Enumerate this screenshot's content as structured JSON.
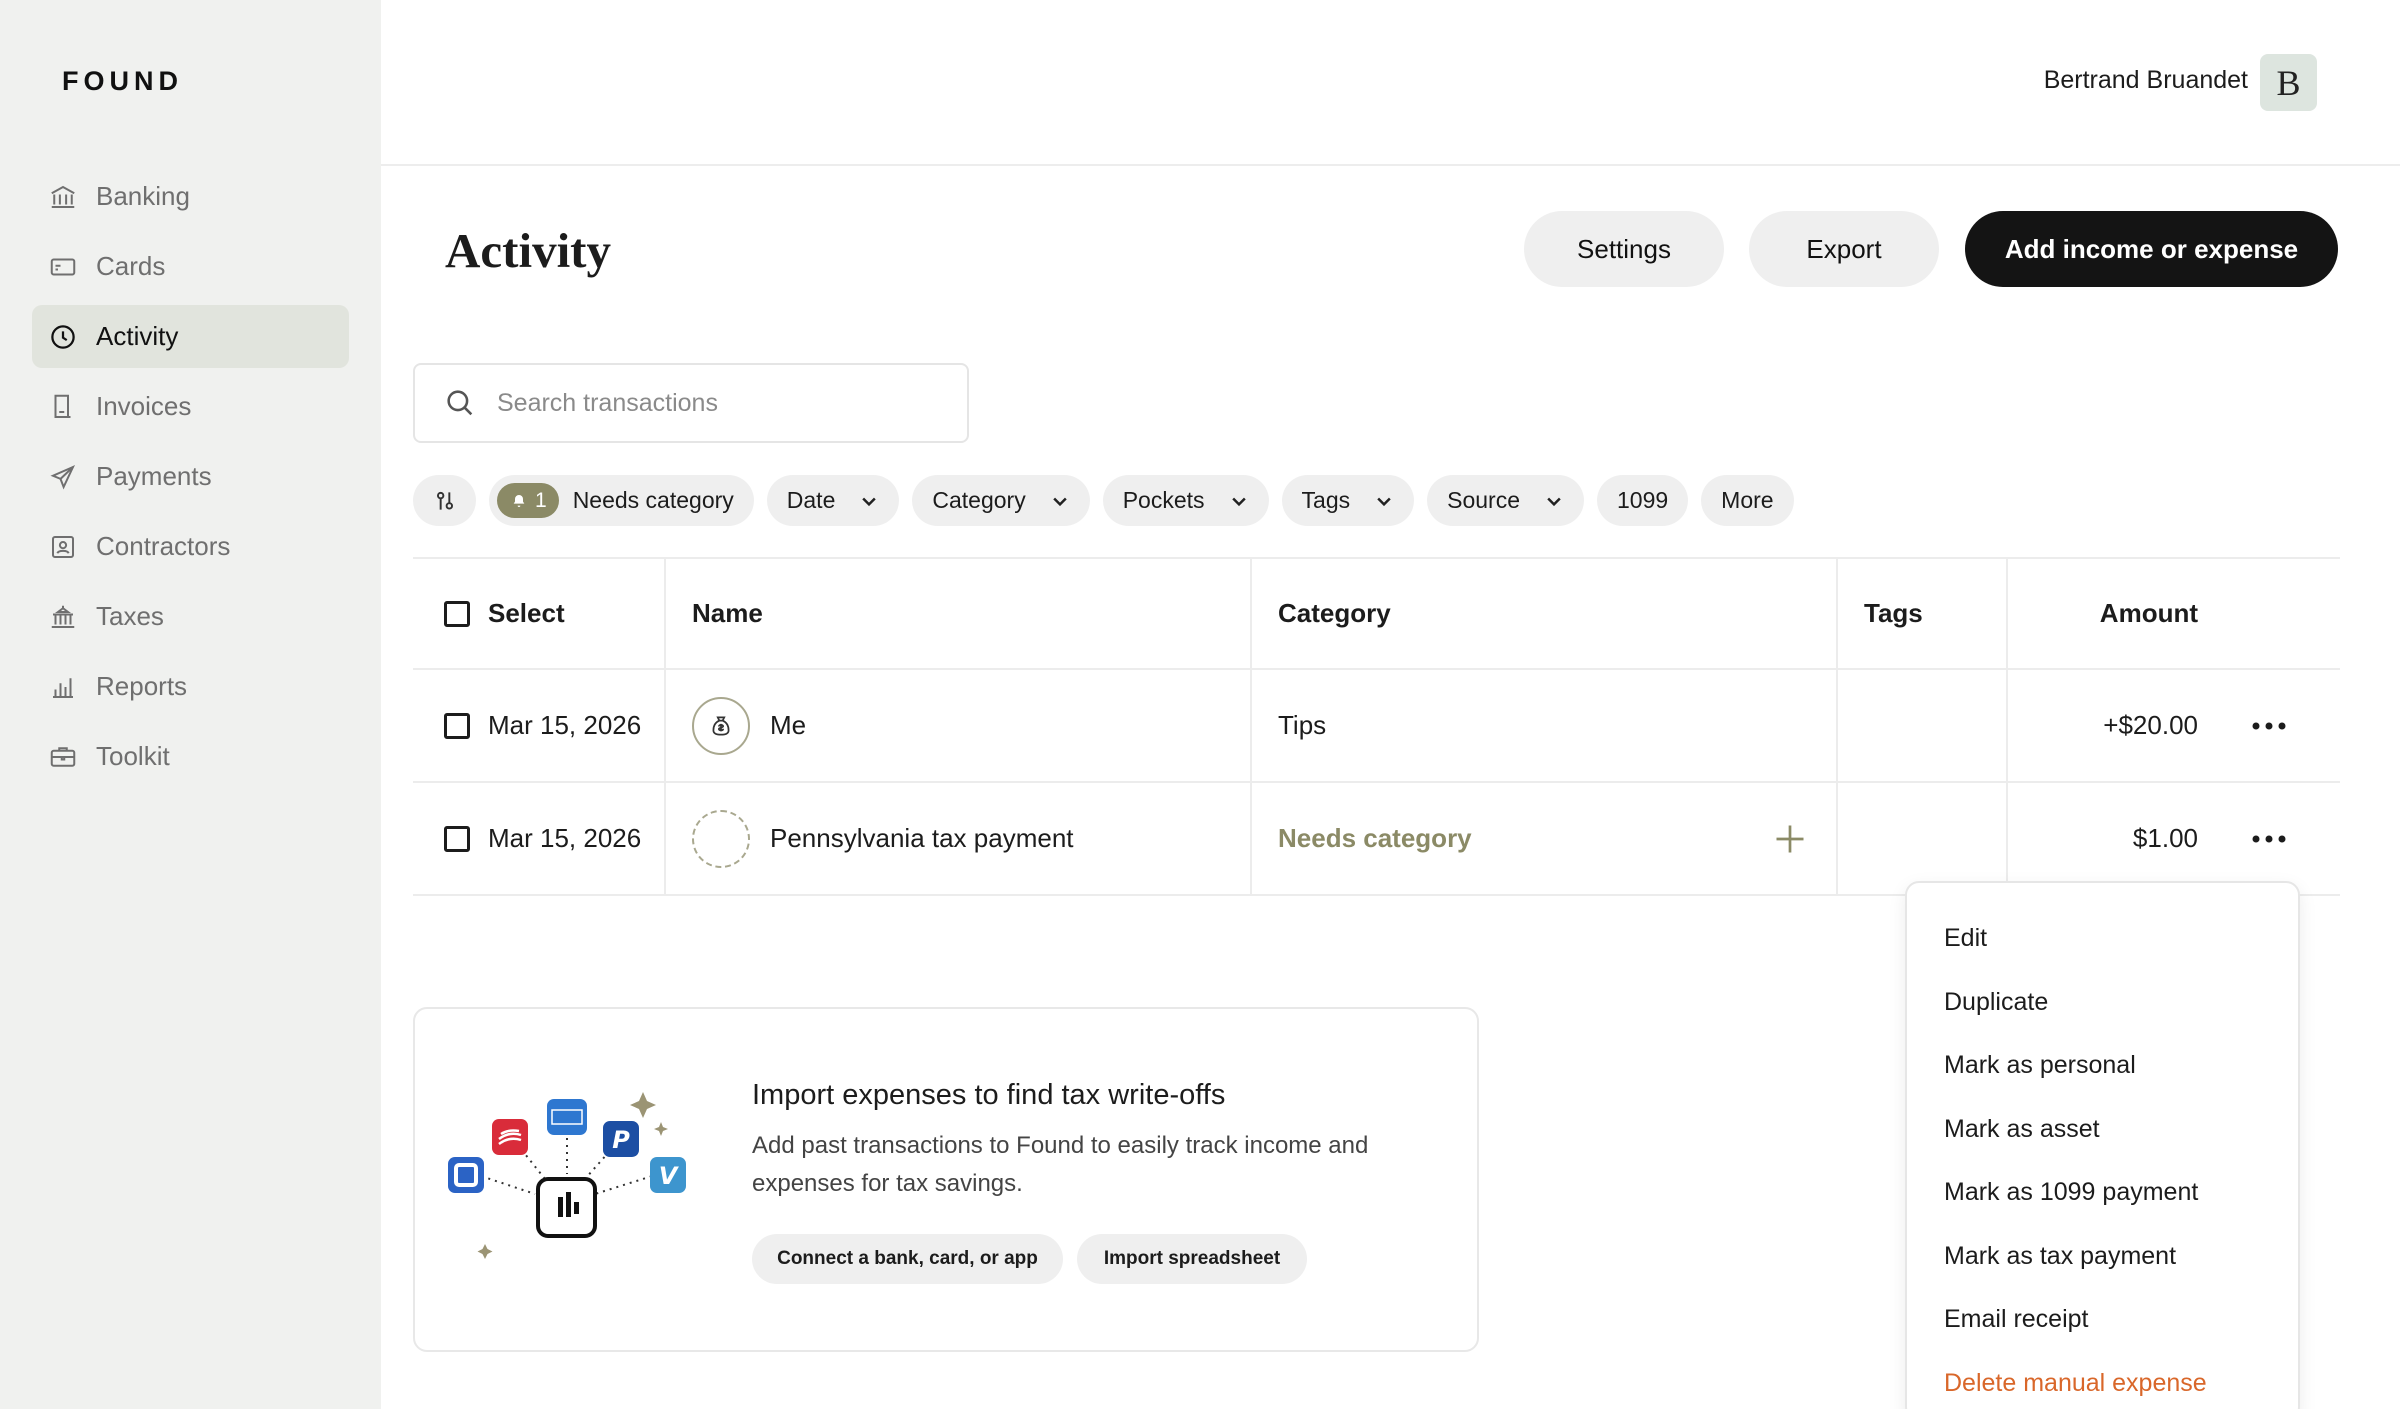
{
  "brand": "FOUND",
  "sidebar": {
    "items": [
      {
        "label": "Banking",
        "icon": "bank-icon"
      },
      {
        "label": "Cards",
        "icon": "card-icon"
      },
      {
        "label": "Activity",
        "icon": "clock-icon",
        "active": true
      },
      {
        "label": "Invoices",
        "icon": "invoice-icon"
      },
      {
        "label": "Payments",
        "icon": "send-icon"
      },
      {
        "label": "Contractors",
        "icon": "contractor-icon"
      },
      {
        "label": "Taxes",
        "icon": "government-icon"
      },
      {
        "label": "Reports",
        "icon": "bar-chart-icon"
      },
      {
        "label": "Toolkit",
        "icon": "briefcase-icon"
      }
    ]
  },
  "user": {
    "name": "Bertrand Bruandet",
    "initial": "B"
  },
  "page": {
    "title": "Activity",
    "settings_label": "Settings",
    "export_label": "Export",
    "add_label": "Add income or expense"
  },
  "search": {
    "placeholder": "Search transactions"
  },
  "filters": {
    "needs_count": "1",
    "needs_label": "Needs category",
    "date": "Date",
    "category": "Category",
    "pockets": "Pockets",
    "tags": "Tags",
    "source": "Source",
    "f1099": "1099",
    "more": "More"
  },
  "table": {
    "headers": {
      "select": "Select",
      "name": "Name",
      "category": "Category",
      "tags": "Tags",
      "amount": "Amount"
    },
    "rows": [
      {
        "date": "Mar 15, 2026",
        "name": "Me",
        "category": "Tips",
        "tags": "",
        "amount": "+$20.00"
      },
      {
        "date": "Mar 15, 2026",
        "name": "Pennsylvania tax payment",
        "category": "Needs category",
        "tags": "",
        "amount": "$1.00"
      }
    ]
  },
  "menu": {
    "items": [
      "Edit",
      "Duplicate",
      "Mark as personal",
      "Mark as asset",
      "Mark as 1099 payment",
      "Mark as tax payment",
      "Email receipt",
      "Delete manual expense"
    ]
  },
  "import": {
    "title": "Import expenses to find tax write-offs",
    "description": "Add past transactions to Found to easily track income and expenses for tax savings.",
    "connect_label": "Connect a bank, card, or app",
    "spreadsheet_label": "Import spreadsheet"
  },
  "colors": {
    "accent": "#8b8a66",
    "danger": "#d9672a",
    "primary": "#141414",
    "sidebar_bg": "#f0f1ef"
  }
}
